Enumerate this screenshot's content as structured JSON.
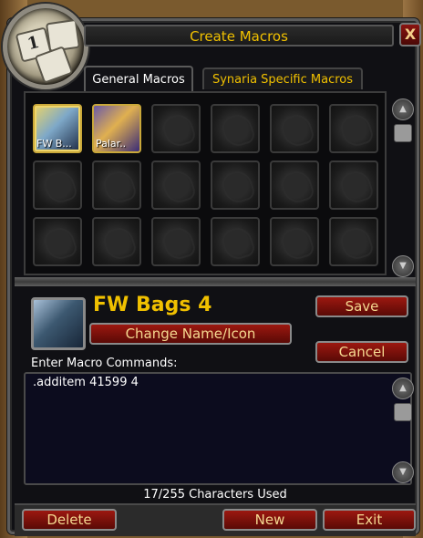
{
  "window": {
    "title": "Create Macros",
    "close_label": "X"
  },
  "tabs": [
    {
      "label": "General Macros",
      "active": true
    },
    {
      "label": "Synaria Specific Macros",
      "active": false
    }
  ],
  "macro_slots": [
    {
      "label": "FW B...",
      "filled": true,
      "selected": true,
      "icon": "blue-armor-icon"
    },
    {
      "label": "Palar..",
      "filled": true,
      "selected": false,
      "icon": "gold-helmet-icon"
    },
    {
      "label": "",
      "filled": false
    },
    {
      "label": "",
      "filled": false
    },
    {
      "label": "",
      "filled": false
    },
    {
      "label": "",
      "filled": false
    },
    {
      "label": "",
      "filled": false
    },
    {
      "label": "",
      "filled": false
    },
    {
      "label": "",
      "filled": false
    },
    {
      "label": "",
      "filled": false
    },
    {
      "label": "",
      "filled": false
    },
    {
      "label": "",
      "filled": false
    },
    {
      "label": "",
      "filled": false
    },
    {
      "label": "",
      "filled": false
    },
    {
      "label": "",
      "filled": false
    },
    {
      "label": "",
      "filled": false
    },
    {
      "label": "",
      "filled": false
    },
    {
      "label": "",
      "filled": false
    }
  ],
  "selected_macro": {
    "name": "FW Bags 4",
    "change_label": "Change Name/Icon",
    "save_label": "Save",
    "cancel_label": "Cancel"
  },
  "editor": {
    "label": "Enter Macro Commands:",
    "text": ".additem 41599 4",
    "chars_used": "17/255 Characters Used"
  },
  "footer": {
    "delete_label": "Delete",
    "new_label": "New",
    "exit_label": "Exit"
  },
  "colors": {
    "title_gold": "#f0c000",
    "button_red": "#9c1810",
    "panel_dark": "#101014"
  }
}
